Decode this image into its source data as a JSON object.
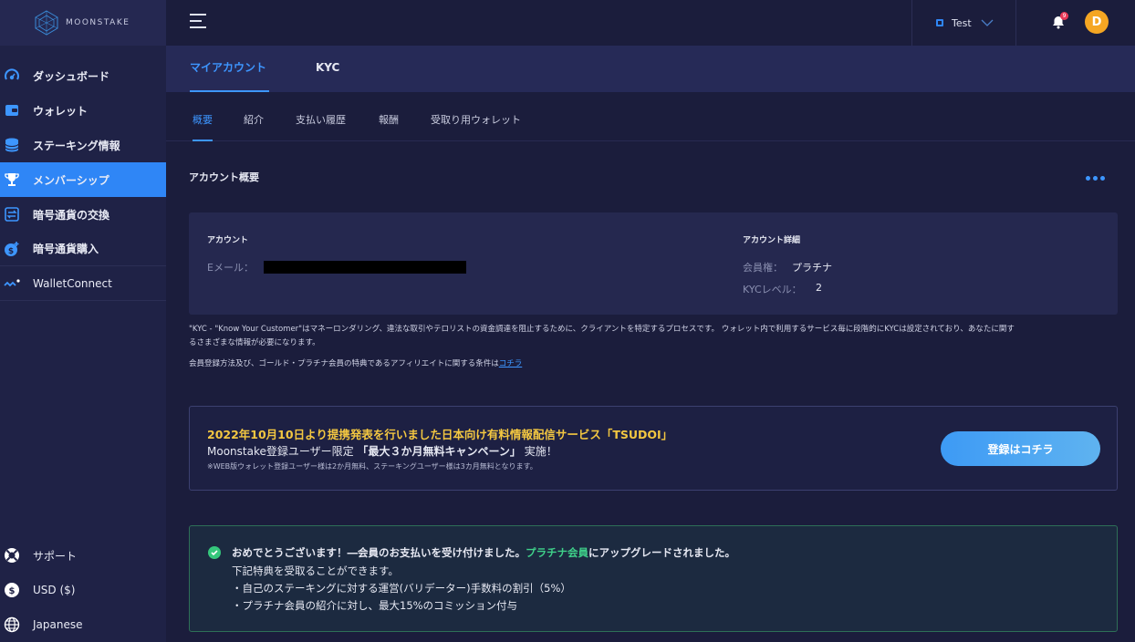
{
  "brand": {
    "name": "MOONSTAKE"
  },
  "sidebar": {
    "items": [
      {
        "label": "ダッシュボード"
      },
      {
        "label": "ウォレット"
      },
      {
        "label": "ステーキング情報"
      },
      {
        "label": "メンバーシップ"
      },
      {
        "label": "暗号通貨の交換"
      },
      {
        "label": "暗号通貨購入"
      },
      {
        "label": "WalletConnect"
      }
    ],
    "bottom": [
      {
        "label": "サポート"
      },
      {
        "label": "USD ($)"
      },
      {
        "label": "Japanese"
      }
    ]
  },
  "header": {
    "account_name": "Test",
    "notification_count": "9",
    "avatar_initial": "D"
  },
  "top_tabs": [
    {
      "label": "マイアカウント"
    },
    {
      "label": "KYC"
    }
  ],
  "sub_tabs": [
    {
      "label": "概要"
    },
    {
      "label": "紹介"
    },
    {
      "label": "支払い履歴"
    },
    {
      "label": "報酬"
    },
    {
      "label": "受取り用ウォレット"
    }
  ],
  "overview": {
    "title": "アカウント概要",
    "account_label": "アカウント",
    "email_key": "Eメール：",
    "details_label": "アカウント詳細",
    "membership_key": "会員権：",
    "membership_value": "プラチナ",
    "kyc_key": "KYCレベル：",
    "kyc_value": "2"
  },
  "notes": {
    "kyc_line1": "\"KYC - \"Know Your Customer\"はマネーロンダリング、違法な取引やテロリストの資金調達を阻止するために、クライアントを特定するプロセスです。 ウォレット内で利用するサービス毎に段階的にKYCは設定されており、あなたに関す",
    "kyc_line2": "るさまざまな情報が必要になります。",
    "terms_text": "会員登録方法及び、ゴールド・プラチナ会員の特典であるアフィリエイトに関する条件は",
    "terms_link": "コチラ"
  },
  "promo": {
    "title": "2022年10月10日より提携発表を行いました日本向け有料情報配信サービス「TSUDOI」",
    "sub_prefix": "Moonstake登録ユーザー限定",
    "sub_bold": "「最大３か月無料キャンペーン」",
    "sub_suffix": "実施！",
    "note": "※WEB版ウォレット登録ユーザー様は2か月無料、ステーキングユーザー様は3カ月無料となります。",
    "button": "登録はコチラ"
  },
  "success": {
    "prefix": "おめでとうございます！―会員のお支払いを受け付けました。",
    "highlight": "プラチナ会員",
    "suffix": "にアップグレードされました。",
    "line2": "下記特典を受取ることができます。",
    "line3": "・自己のステーキングに対する運営(バリデーター)手数料の割引（5%）",
    "line4": "・プラチナ会員の紹介に対し、最大15%のコミッション付与"
  },
  "colors": {
    "accent": "#2f86f6",
    "promo_title": "#f3c741",
    "success_green": "#3fd18a",
    "avatar": "#f5a623"
  }
}
